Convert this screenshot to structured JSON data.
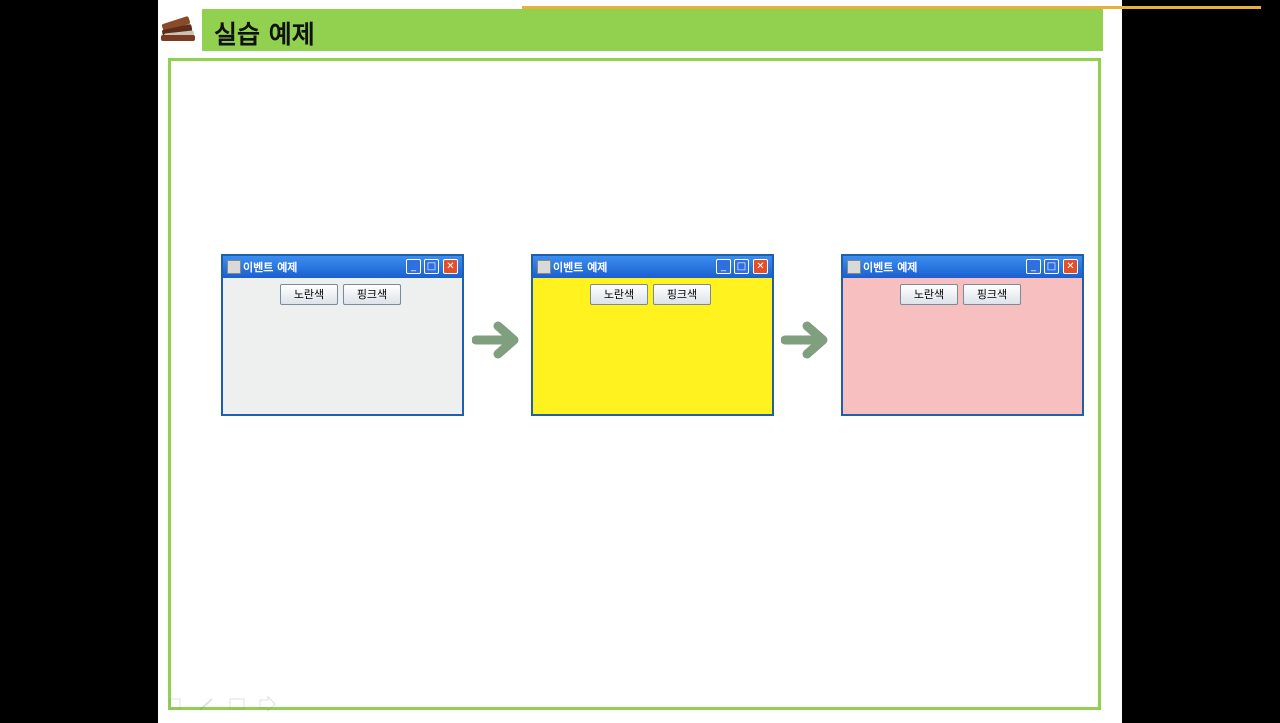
{
  "slide": {
    "title": "실습 예제",
    "accent_color": "#92d050"
  },
  "windows": [
    {
      "title": "이벤트 예제",
      "button1": "노란색",
      "button2": "핑크색",
      "bg_color": "#eef0f0"
    },
    {
      "title": "이벤트 예제",
      "button1": "노란색",
      "button2": "핑크색",
      "bg_color": "#fff21e"
    },
    {
      "title": "이벤트 예제",
      "button1": "노란색",
      "button2": "핑크색",
      "bg_color": "#f8bfc0"
    }
  ],
  "titlebar_controls": [
    "minimize-icon",
    "maximize-icon",
    "close-icon"
  ],
  "arrow_color": "#7f9f7f"
}
